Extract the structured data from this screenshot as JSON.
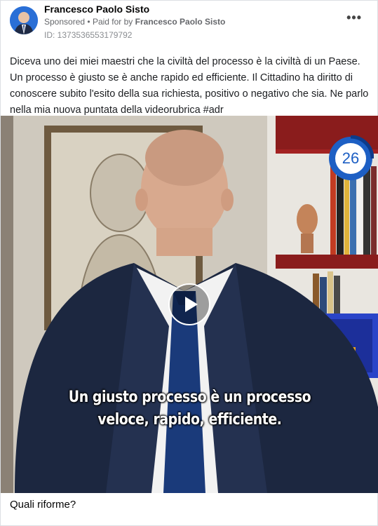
{
  "post": {
    "author_name": "Francesco Paolo Sisto",
    "sponsored_label": "Sponsored",
    "paid_for_prefix": "Paid for by",
    "paid_for_name": "Francesco Paolo Sisto",
    "ad_id": "ID: 1373536553179792",
    "more_label": "•••",
    "caption": "Diceva uno dei miei maestri che la civiltà del processo è la civiltà di un Paese. Un processo è giusto se è anche rapido ed efficiente. Il Cittadino ha diritto di conoscere subito l'esito della sua richiesta, positivo o negativo che sia. Ne parlo nella mia nuova puntata della videorubrica #adr"
  },
  "video": {
    "subtitle_line1": "Un giusto processo è un processo",
    "subtitle_line2": "veloce, rapido, efficiente.",
    "badge_number": "26",
    "play_icon": "play-icon"
  },
  "footer": {
    "headline": "Quali riforme?"
  },
  "colors": {
    "accent": "#1877f2",
    "badge_blue": "#1d5fc4",
    "suit": "#1c2740",
    "tie": "#1a3a7a"
  }
}
